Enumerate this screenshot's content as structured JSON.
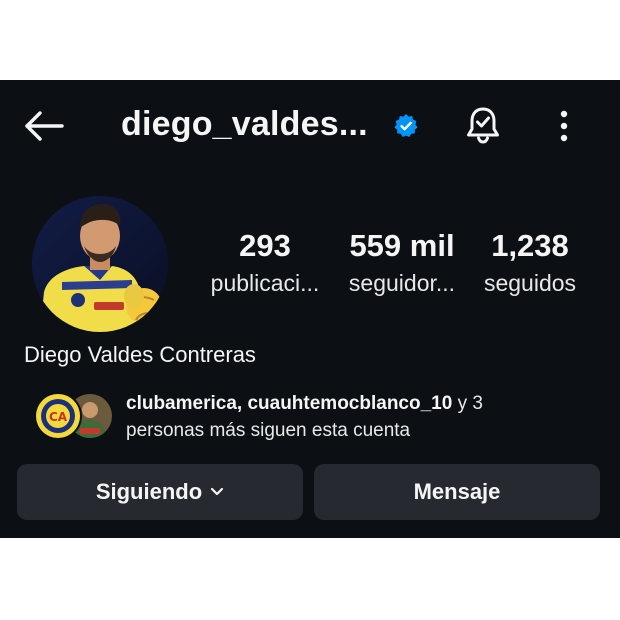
{
  "header": {
    "username": "diego_valdes...",
    "verified": true,
    "icons": {
      "back": "arrow-left-icon",
      "verified": "verified-badge-icon",
      "notifications": "bell-check-icon",
      "more": "more-vertical-icon"
    }
  },
  "profile": {
    "display_name": "Diego Valdes Contreras",
    "stats": [
      {
        "value": "293",
        "label": "publicaci..."
      },
      {
        "value": "559 mil",
        "label": "seguidor..."
      },
      {
        "value": "1,238",
        "label": "seguidos"
      }
    ]
  },
  "followed_by": {
    "names": "clubamerica, cuauhtemocblanco_10",
    "suffix": " y 3",
    "line2": "personas más siguen esta cuenta"
  },
  "actions": {
    "following_label": "Siguiendo",
    "message_label": "Mensaje"
  },
  "colors": {
    "background": "#0c1014",
    "button": "#262a30",
    "verified_blue": "#0095f6",
    "text": "#f5f5f5"
  }
}
